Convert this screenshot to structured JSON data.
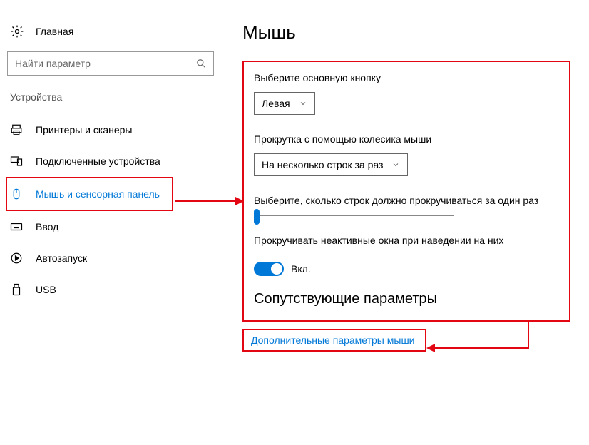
{
  "sidebar": {
    "home_label": "Главная",
    "search_placeholder": "Найти параметр",
    "category": "Устройства",
    "items": [
      {
        "label": "Принтеры и сканеры"
      },
      {
        "label": "Подключенные устройства"
      },
      {
        "label": "Мышь и сенсорная панель"
      },
      {
        "label": "Ввод"
      },
      {
        "label": "Автозапуск"
      },
      {
        "label": "USB"
      }
    ]
  },
  "main": {
    "title": "Мышь",
    "primary_button": {
      "label": "Выберите основную кнопку",
      "value": "Левая"
    },
    "wheel_scroll": {
      "label": "Прокрутка с помощью колесика мыши",
      "value": "На несколько строк за раз"
    },
    "lines_per_scroll": {
      "label": "Выберите, сколько строк должно прокручиваться за один раз"
    },
    "inactive_scroll": {
      "label": "Прокручивать неактивные окна при наведении на них",
      "state": "Вкл."
    },
    "related_title": "Сопутствующие параметры",
    "related_link": "Дополнительные параметры мыши"
  }
}
